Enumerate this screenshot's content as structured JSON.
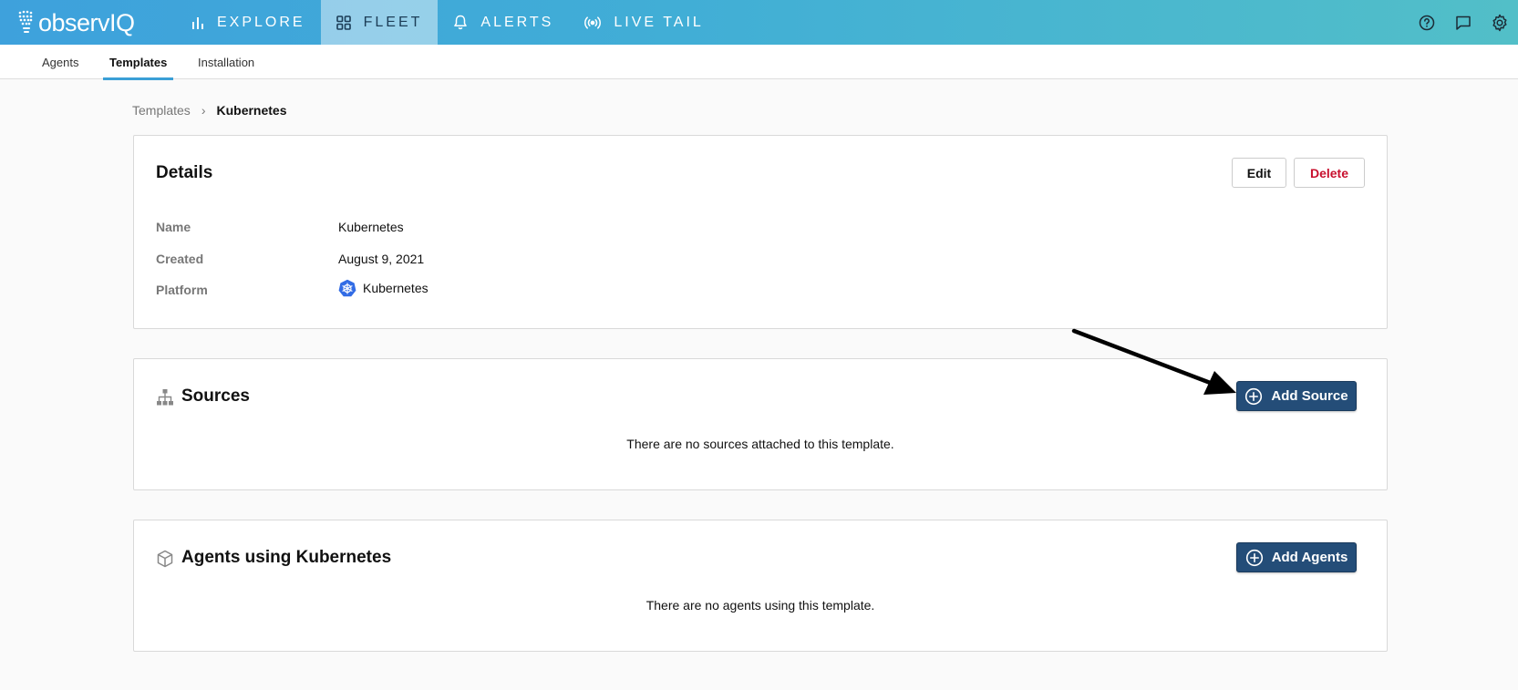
{
  "app": {
    "logo_text": "observIQ"
  },
  "nav": [
    {
      "label": "EXPLORE",
      "icon": "bar-chart-icon",
      "active": false
    },
    {
      "label": "FLEET",
      "icon": "grid-icon",
      "active": true
    },
    {
      "label": "ALERTS",
      "icon": "bell-icon",
      "active": false
    },
    {
      "label": "LIVE TAIL",
      "icon": "broadcast-icon",
      "active": false
    }
  ],
  "top_icons": [
    "help-icon",
    "chat-icon",
    "settings-icon"
  ],
  "subnav": [
    {
      "label": "Agents",
      "active": false
    },
    {
      "label": "Templates",
      "active": true
    },
    {
      "label": "Installation",
      "active": false
    }
  ],
  "breadcrumb": {
    "parent": "Templates",
    "separator": "›",
    "current": "Kubernetes"
  },
  "details": {
    "title": "Details",
    "edit_label": "Edit",
    "delete_label": "Delete",
    "fields": [
      {
        "label": "Name",
        "value": "Kubernetes"
      },
      {
        "label": "Created",
        "value": "August 9, 2021"
      },
      {
        "label": "Platform",
        "value": "Kubernetes",
        "icon": "kubernetes-icon"
      }
    ]
  },
  "sources": {
    "title": "Sources",
    "icon": "hierarchy-icon",
    "add_label": "Add Source",
    "empty_text": "There are no sources attached to this template."
  },
  "agents": {
    "title": "Agents using Kubernetes",
    "icon": "cube-icon",
    "add_label": "Add Agents",
    "empty_text": "There are no agents using this template."
  },
  "colors": {
    "primary": "#244d78",
    "delete": "#c8102e",
    "accent": "#3a9fd6"
  }
}
